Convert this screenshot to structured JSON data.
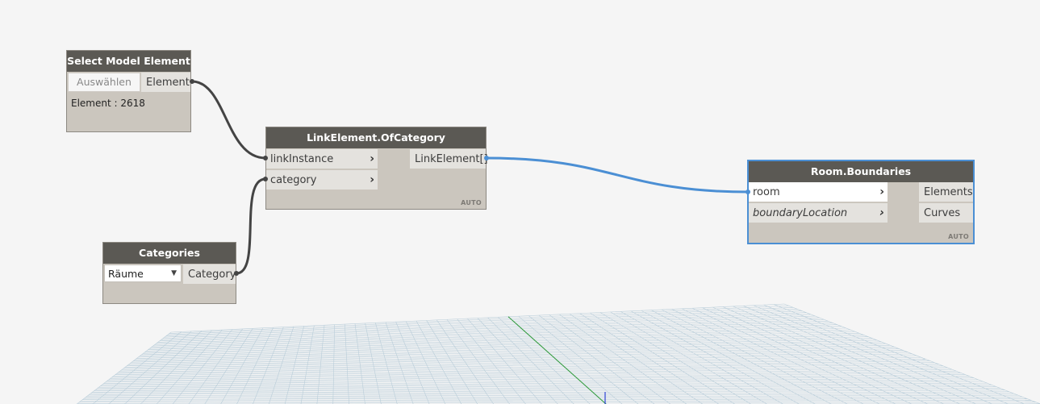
{
  "nodes": {
    "select_model_element": {
      "title": "Select Model Element",
      "button_label": "Auswählen",
      "output": "Element",
      "value": "Element : 2618"
    },
    "link_element_of_category": {
      "title": "LinkElement.OfCategory",
      "inputs": [
        "linkInstance",
        "category"
      ],
      "output": "LinkElement[]",
      "lacing": "AUTO"
    },
    "categories": {
      "title": "Categories",
      "selected_option": "Räume",
      "output": "Category"
    },
    "room_boundaries": {
      "title": "Room.Boundaries",
      "inputs": [
        "room",
        "boundaryLocation"
      ],
      "outputs": [
        "Elements",
        "Curves"
      ],
      "lacing": "AUTO"
    }
  },
  "icons": {
    "input_port": "chevron-right-icon",
    "dropdown": "chevron-down-icon"
  },
  "colors": {
    "node_header": "#5b5954",
    "node_body": "#cbc6be",
    "wire": "#444444",
    "selected_wire": "#4b8fd4",
    "grid_line": "#b9cdd9",
    "axis_green": "#2e9a3a",
    "axis_blue": "#2f43d6"
  }
}
